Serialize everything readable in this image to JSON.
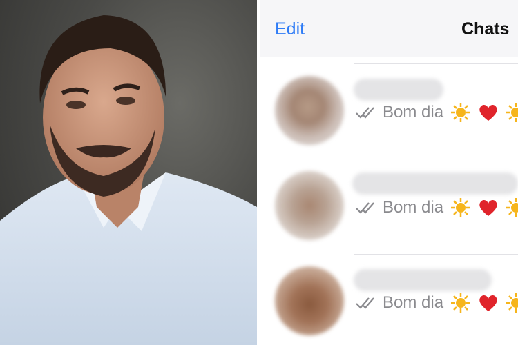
{
  "chat_list": {
    "edit_label": "Edit",
    "title": "Chats",
    "rows": [
      {
        "preview": "Bom dia",
        "icons": [
          "double-check-icon",
          "sun-icon",
          "heart-icon",
          "sun-icon"
        ]
      },
      {
        "preview": "Bom dia",
        "icons": [
          "double-check-icon",
          "sun-icon",
          "heart-icon",
          "sun-icon"
        ]
      },
      {
        "preview": "Bom dia",
        "icons": [
          "double-check-icon",
          "sun-icon",
          "heart-icon",
          "sun-icon"
        ]
      }
    ]
  },
  "colors": {
    "accent": "#2f7cf6",
    "heart": "#e0242b",
    "sun": "#f6b51c",
    "preview_text": "#8a8a8e"
  }
}
